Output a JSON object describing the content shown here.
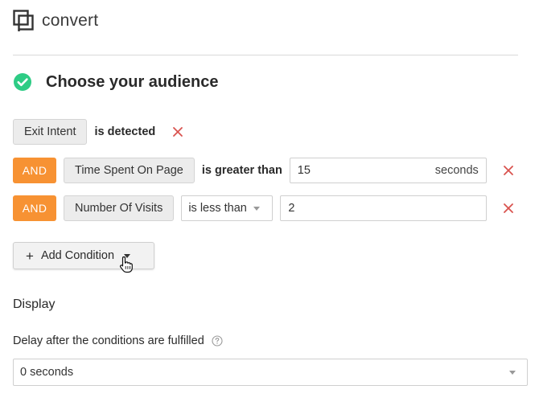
{
  "app": {
    "logo_text": "convert"
  },
  "audience": {
    "title": "Choose your audience",
    "conditions": [
      {
        "condition": "Exit Intent",
        "operator": "is detected"
      },
      {
        "connector": "AND",
        "condition": "Time Spent On Page",
        "operator": "is greater than",
        "value": "15",
        "unit": "seconds"
      },
      {
        "connector": "AND",
        "condition": "Number Of Visits",
        "operator": "is less than",
        "value": "2"
      }
    ],
    "add_condition_label": "Add Condition"
  },
  "display": {
    "heading": "Display",
    "delay_label": "Delay after the conditions are fulfilled",
    "delay_value": "0 seconds"
  },
  "icons": {
    "logo": "convert-logo-icon",
    "check": "check-circle-icon",
    "remove": "close-x-icon",
    "plus": "plus-icon",
    "help": "help-circle-icon",
    "cursor": "hand-pointer-cursor-icon"
  },
  "colors": {
    "accent_orange": "#f79233",
    "success_green": "#2ecc85",
    "remove_red": "#d9534f"
  }
}
